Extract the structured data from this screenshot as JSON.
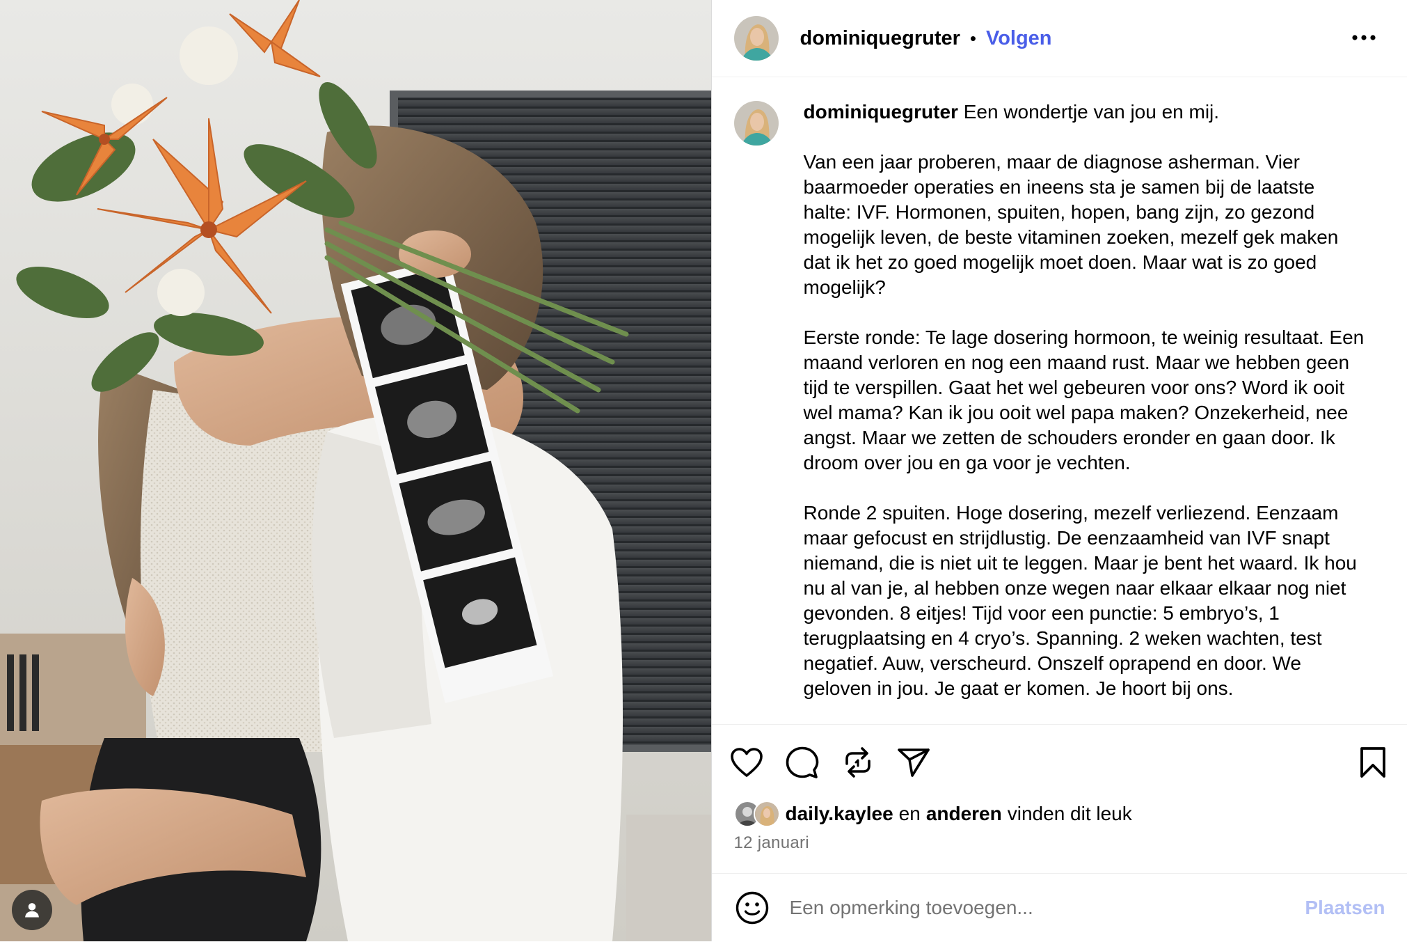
{
  "post": {
    "author": "dominiquegruter",
    "follow_label": "Volgen",
    "separator": "•",
    "more_icon": "more-horizontal-icon",
    "caption": {
      "username": "dominiquegruter",
      "first_line": "Een wondertje van jou en mij.",
      "paragraphs": [
        "Van een jaar proberen, maar de diagnose asherman. Vier baarmoeder operaties en ineens sta je samen bij de laatste halte: IVF. Hormonen, spuiten, hopen, bang zijn, zo gezond mogelijk leven, de beste vitaminen zoeken, mezelf gek maken dat ik het zo goed mogelijk moet doen. Maar wat is zo goed mogelijk?",
        "Eerste ronde: Te lage dosering hormoon, te weinig resultaat. Een maand verloren en nog een maand rust. Maar we hebben geen tijd te verspillen. Gaat het wel gebeuren voor ons? Word ik ooit wel mama? Kan ik jou ooit wel papa maken? Onzekerheid, nee angst. Maar we zetten de schouders eronder en gaan door. Ik droom over jou en ga voor je vechten.",
        "Ronde 2 spuiten. Hoge dosering, mezelf verliezend. Eenzaam maar gefocust en strijdlustig. De eenzaamheid van IVF snapt niemand, die is niet uit te leggen. Maar je bent het waard. Ik hou nu al van je, al hebben onze wegen naar elkaar elkaar nog niet gevonden. 8 eitjes! Tijd voor een punctie: 5 embryo’s, 1 terugplaatsing en 4 cryo’s. Spanning. 2 weken wachten, test negatief. Auw, verscheurd. Onszelf oprapend en door. We geloven in jou. Je gaat er komen. Je hoort bij ons."
      ]
    },
    "actions": {
      "like_icon": "heart-icon",
      "comment_icon": "comment-icon",
      "repost_icon": "repost-icon",
      "share_icon": "send-icon",
      "save_icon": "bookmark-icon"
    },
    "likes": {
      "liker": "daily.kaylee",
      "connector": "en",
      "others": "anderen",
      "suffix": "vinden dit leuk"
    },
    "date": "12 januari",
    "comment": {
      "placeholder": "Een opmerking toevoegen...",
      "submit_label": "Plaatsen",
      "emoji_icon": "smiley-icon"
    },
    "photo": {
      "tag_icon": "user-tag-icon"
    }
  },
  "colors": {
    "link_blue": "#4a5ee8",
    "disabled_blue": "#b2bff5",
    "secondary_text": "#737373",
    "divider": "#efefef"
  }
}
